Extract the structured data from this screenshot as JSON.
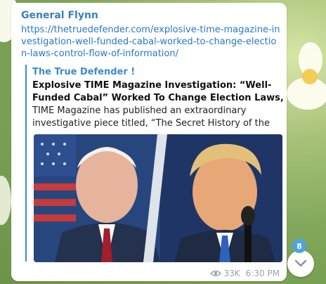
{
  "message": {
    "sender": "General Flynn",
    "link": "https://thetruedefender.com/explosive-time-magazine-investigation-well-funded-cabal-worked-to-change-election-laws-control-flow-of-information/",
    "preview": {
      "site_name": "The True Defender !",
      "title": "Explosive TIME Magazine Investigation: “Well-Funded Cabal” Worked To Change Election Laws, Control Flow ...",
      "description": "TIME Magazine has published an extraordinary investigative piece titled, “The Secret History of the Shado..."
    },
    "views": "33K",
    "time": "6:30 PM"
  },
  "scroll_down": {
    "unread_count": "8"
  }
}
